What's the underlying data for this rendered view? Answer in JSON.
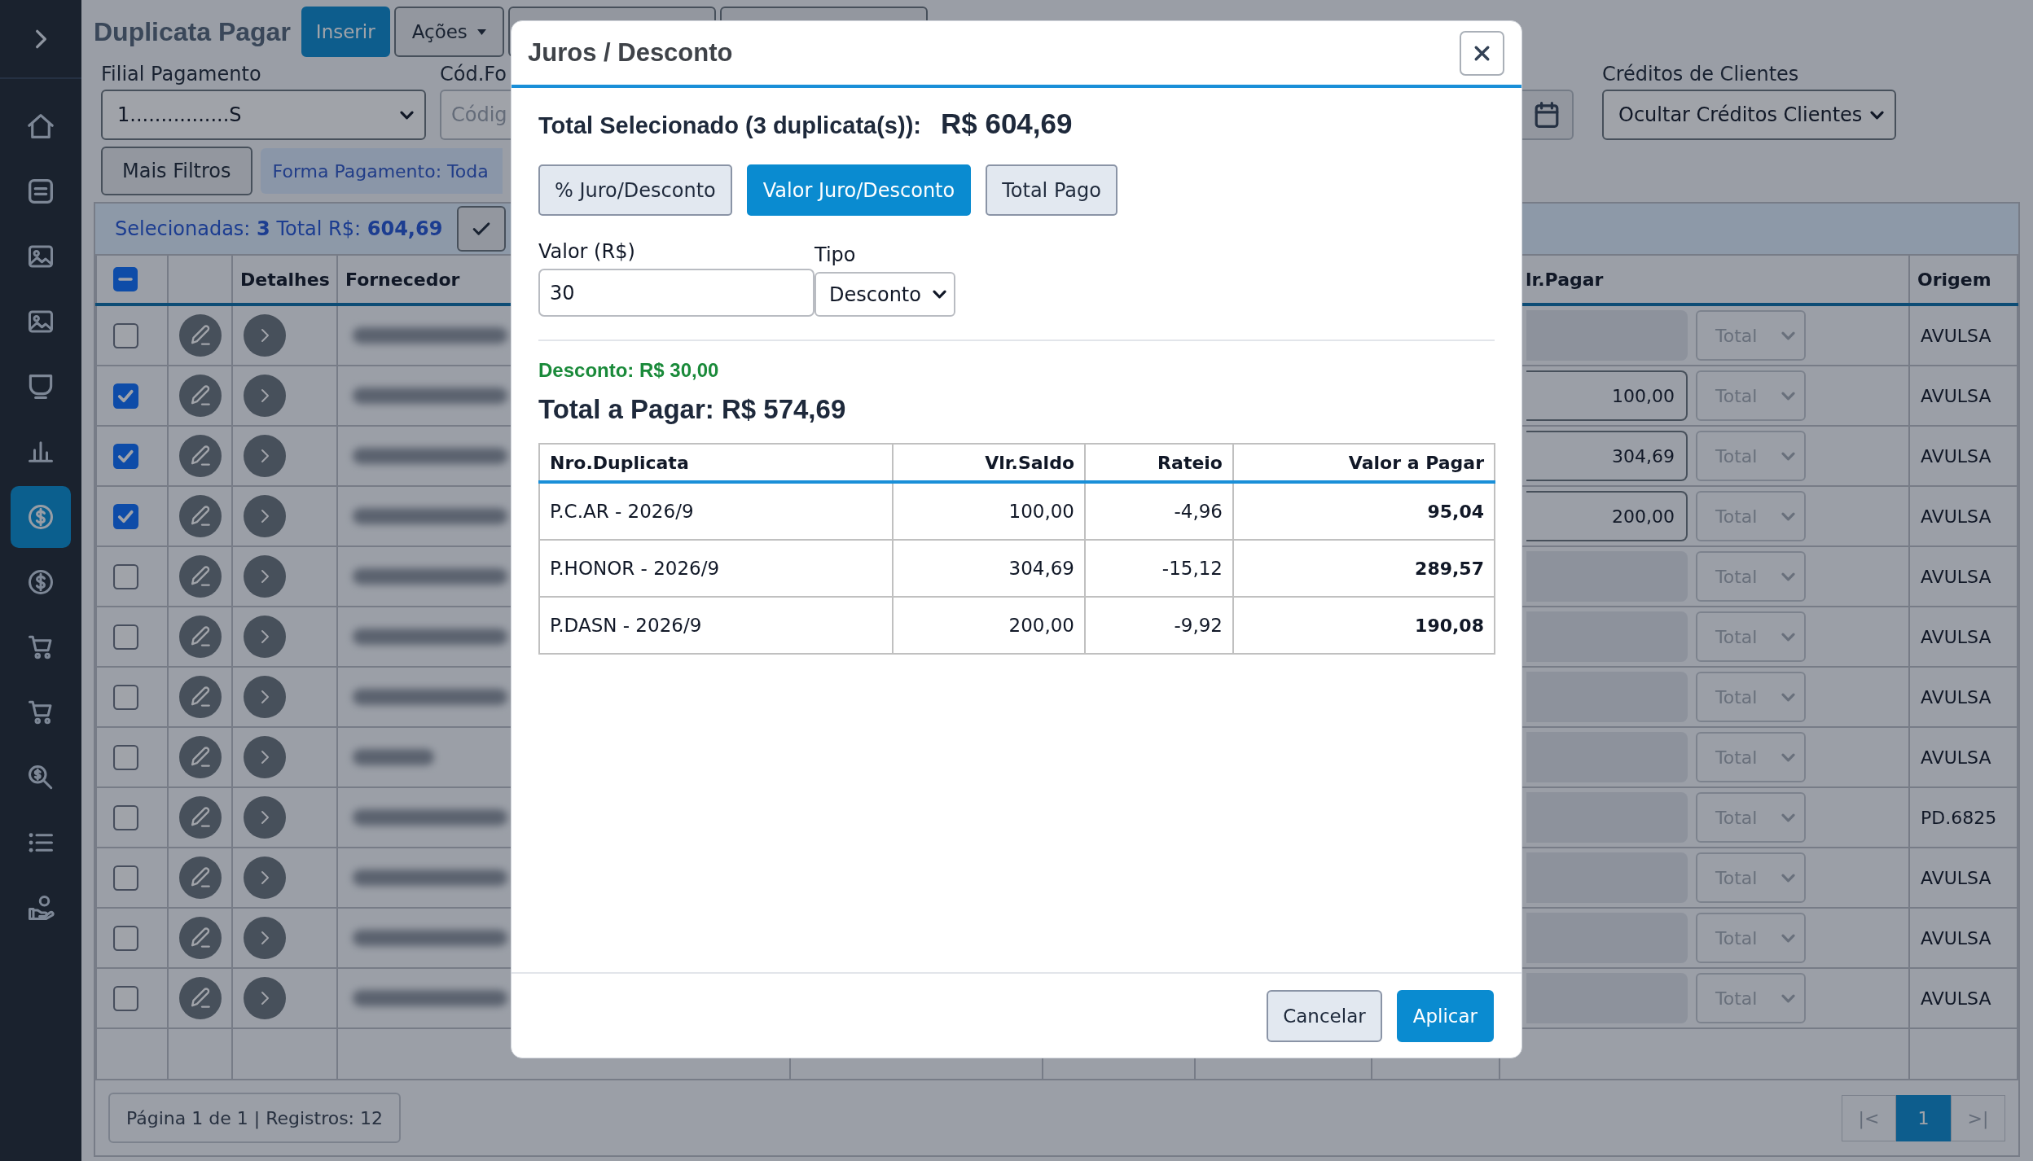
{
  "sidebar": {
    "items": [
      {
        "selected": false
      },
      {
        "selected": false
      },
      {
        "selected": false
      },
      {
        "selected": false
      },
      {
        "selected": false
      },
      {
        "selected": false
      },
      {
        "selected": true
      },
      {
        "selected": false
      },
      {
        "selected": false
      },
      {
        "selected": false
      },
      {
        "selected": false
      },
      {
        "selected": false
      },
      {
        "selected": false
      }
    ]
  },
  "header": {
    "title": "Duplicata Pagar",
    "actions": [
      {
        "label": "Inserir",
        "kind": "primary"
      },
      {
        "label": "Ações",
        "kind": "menu"
      },
      {
        "kind": "plain"
      },
      {
        "kind": "plain"
      }
    ]
  },
  "filters": [
    {
      "kind": "select",
      "label": "Filial Pagamento",
      "value": "1................S"
    },
    {
      "kind": "input",
      "label": "Cód.Fo",
      "placeholder": "Códig"
    },
    {
      "kind": "date"
    },
    {
      "kind": "select",
      "label": "Créditos de Clientes",
      "value": "Ocultar Créditos Clientes"
    }
  ],
  "more_filters": {
    "button": "Mais Filtros",
    "chips": [
      "Forma Pagamento: Toda"
    ]
  },
  "selection_bar": {
    "text": "Selecionadas: **3** Total R$: **604,69**"
  },
  "table": {
    "select_all": {
      "indeterminate": true
    },
    "columns": [
      {
        "label": "Detalhes"
      },
      {
        "label": "Fornecedor"
      },
      {
        "label": "lr.Pagar"
      },
      {
        "label": "Origem"
      }
    ],
    "rows": [
      {
        "selected": false,
        "amount": {
          "disabled": true
        },
        "mode": {
          "value": "Total",
          "disabled": true
        },
        "origin": "AVULSA"
      },
      {
        "selected": true,
        "amount": {
          "value": "100,00",
          "disabled": false
        },
        "mode": {
          "value": "Total",
          "disabled": true
        },
        "origin": "AVULSA"
      },
      {
        "selected": true,
        "amount": {
          "value": "304,69",
          "disabled": false
        },
        "mode": {
          "value": "Total",
          "disabled": true
        },
        "origin": "AVULSA"
      },
      {
        "selected": true,
        "amount": {
          "value": "200,00",
          "disabled": false
        },
        "mode": {
          "value": "Total",
          "disabled": true
        },
        "origin": "AVULSA"
      },
      {
        "selected": false,
        "amount": {
          "disabled": true
        },
        "mode": {
          "value": "Total",
          "disabled": true
        },
        "origin": "AVULSA"
      },
      {
        "selected": false,
        "amount": {
          "disabled": true
        },
        "mode": {
          "value": "Total",
          "disabled": true
        },
        "origin": "AVULSA"
      },
      {
        "selected": false,
        "amount": {
          "disabled": true
        },
        "mode": {
          "value": "Total",
          "disabled": true
        },
        "origin": "AVULSA"
      },
      {
        "selected": false,
        "amount": {
          "disabled": true
        },
        "mode": {
          "value": "Total",
          "disabled": true
        },
        "origin": "AVULSA"
      },
      {
        "selected": false,
        "amount": {
          "disabled": true
        },
        "mode": {
          "value": "Total",
          "disabled": true
        },
        "origin": "PD.6825"
      },
      {
        "selected": false,
        "amount": {
          "disabled": true
        },
        "mode": {
          "value": "Total",
          "disabled": true
        },
        "origin": "AVULSA"
      },
      {
        "selected": false,
        "amount": {
          "disabled": true
        },
        "mode": {
          "value": "Total",
          "disabled": true
        },
        "origin": "AVULSA"
      },
      {
        "selected": false,
        "amount": {
          "disabled": true
        },
        "mode": {
          "value": "Total",
          "disabled": true
        },
        "origin": "AVULSA"
      }
    ]
  },
  "pagination": {
    "summary": "Página 1 de 1 | Registros: 12",
    "pages": [
      {
        "label": "|<",
        "selected": false,
        "disabled": true
      },
      {
        "label": "1",
        "selected": true,
        "disabled": false
      },
      {
        "label": ">|",
        "selected": false,
        "disabled": true
      }
    ]
  },
  "modal": {
    "title": "Juros / Desconto",
    "summary": {
      "label": "Total Selecionado (3 duplicata(s)):",
      "value": "R$ 604,69"
    },
    "modes": [
      {
        "label": "% Juro/Desconto",
        "selected": false
      },
      {
        "label": "Valor Juro/Desconto",
        "selected": true
      },
      {
        "label": "Total Pago",
        "selected": false
      }
    ],
    "fields": [
      {
        "kind": "input",
        "label": "Valor (R$)",
        "value": "30"
      },
      {
        "kind": "select",
        "label": "Tipo",
        "value": "Desconto"
      }
    ],
    "adjustment": {
      "kind": "discount",
      "text": "Desconto: R$ 30,00"
    },
    "total": "Total a Pagar: R$ 574,69",
    "table": {
      "columns": [
        "Nro.Duplicata",
        "Vlr.Saldo",
        "Rateio",
        "Valor a Pagar"
      ],
      "rows": [
        [
          "P.C.AR - 2026/9",
          "100,00",
          "-4,96",
          "95,04"
        ],
        [
          "P.HONOR - 2026/9",
          "304,69",
          "-15,12",
          "289,57"
        ],
        [
          "P.DASN - 2026/9",
          "200,00",
          "-9,92",
          "190,08"
        ]
      ]
    },
    "buttons": [
      {
        "label": "Cancelar",
        "kind": "secondary"
      },
      {
        "label": "Aplicar",
        "kind": "primary"
      }
    ]
  }
}
